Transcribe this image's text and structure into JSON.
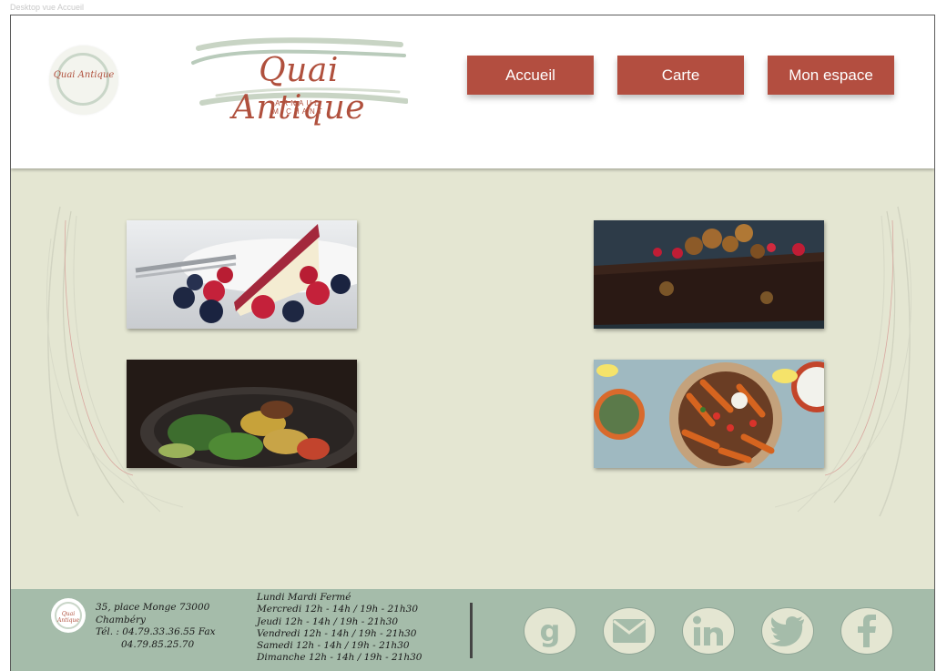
{
  "frame_label": "Desktop vue Accueil",
  "brand": {
    "name": "Quai Antique",
    "subtitle_line1": "ARNAUD",
    "subtitle_line2": "MICHANT",
    "accent_color": "#b34e40",
    "logo_icon": "restaurant-logo-icon"
  },
  "nav": {
    "items": [
      {
        "label": "Accueil"
      },
      {
        "label": "Carte"
      },
      {
        "label": "Mon espace"
      }
    ]
  },
  "gallery": {
    "images": [
      {
        "alt": "cheesecake-with-berries"
      },
      {
        "alt": "chocolate-walnut-cake"
      },
      {
        "alt": "salad-bowl"
      },
      {
        "alt": "sweet-potato-fries-salad"
      }
    ]
  },
  "footer": {
    "address": {
      "line1": "35, place Monge 73000",
      "line2": "Chambéry",
      "line3": "Tél. : 04.79.33.36.55 Fax",
      "line4": "04.79.85.25.70"
    },
    "hours": [
      "Lundi Mardi Fermé",
      "Mercredi 12h - 14h / 19h - 21h30",
      "Jeudi 12h - 14h / 19h - 21h30",
      "Vendredi 12h - 14h / 19h - 21h30",
      "Samedi 12h - 14h / 19h - 21h30",
      "Dimanche 12h - 14h / 19h - 21h30"
    ],
    "social_icons": [
      "google-icon",
      "email-icon",
      "linkedin-icon",
      "twitter-icon",
      "facebook-icon"
    ]
  },
  "colors": {
    "background": "#e4e6d2",
    "footer": "#a5bcaa",
    "button": "#b34e40"
  }
}
